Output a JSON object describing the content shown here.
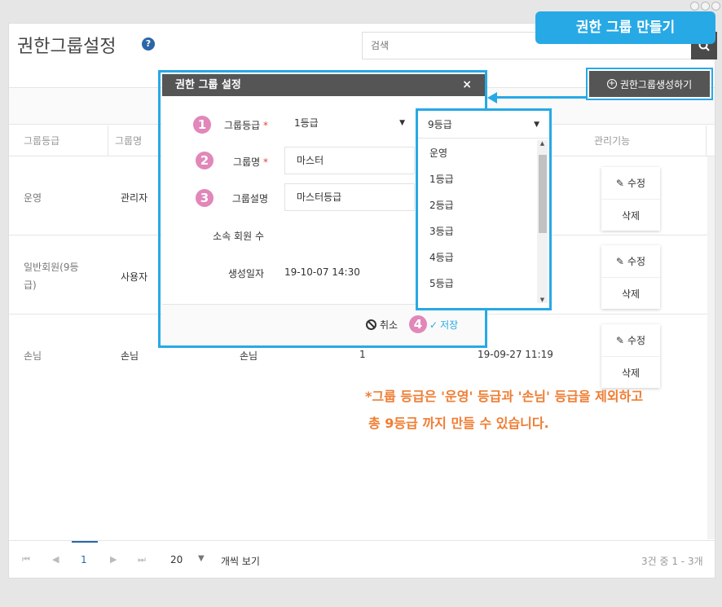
{
  "page": {
    "title": "권한그룹설정",
    "search_placeholder": "검색",
    "callout": "권한 그룹 만들기",
    "create_button": "권한그룹생성하기"
  },
  "table": {
    "headers": [
      "그룹등급",
      "그룹명",
      "관리기능"
    ],
    "rows": [
      {
        "grade": "운영",
        "name": "관리자",
        "edit": "수정",
        "delete": "삭제"
      },
      {
        "grade": "일반회원(9등",
        "grade2": "급)",
        "name": "사용자",
        "edit": "수정",
        "delete": "삭제"
      },
      {
        "grade": "손님",
        "name": "손님",
        "desc": "손님",
        "count": "1",
        "date": "19-09-27 11:19",
        "edit": "수정",
        "delete": "삭제"
      }
    ]
  },
  "footer": {
    "page": "1",
    "page_size": "20",
    "per_page_label": "개씩 보기",
    "summary": "3건 중 1 - 3개"
  },
  "note": {
    "line1": "*그룹 등급은 '운영' 등급과 '손님' 등급을 제외하고",
    "line2": "총 9등급 까지 만들 수 있습니다."
  },
  "modal": {
    "title": "권한 그룹 설정",
    "close": "×",
    "labels": {
      "grade": "그룹등급",
      "name": "그룹명",
      "desc": "그룹설명",
      "members": "소속 회원 수",
      "created": "생성일자"
    },
    "required_mark": "*",
    "values": {
      "grade": "1등급",
      "name": "마스터",
      "desc": "마스터등급",
      "created": "19-10-07 14:30"
    },
    "badges": [
      "1",
      "2",
      "3",
      "4"
    ],
    "cancel": "취소",
    "save": "저장"
  },
  "dropdown": {
    "selected": "9등급",
    "options": [
      "운영",
      "1등급",
      "2등급",
      "3등급",
      "4등급",
      "5등급"
    ]
  },
  "colors": {
    "accent": "#27a9e6",
    "badge": "#e187ba",
    "note": "#ef7d33",
    "header": "#555555"
  }
}
